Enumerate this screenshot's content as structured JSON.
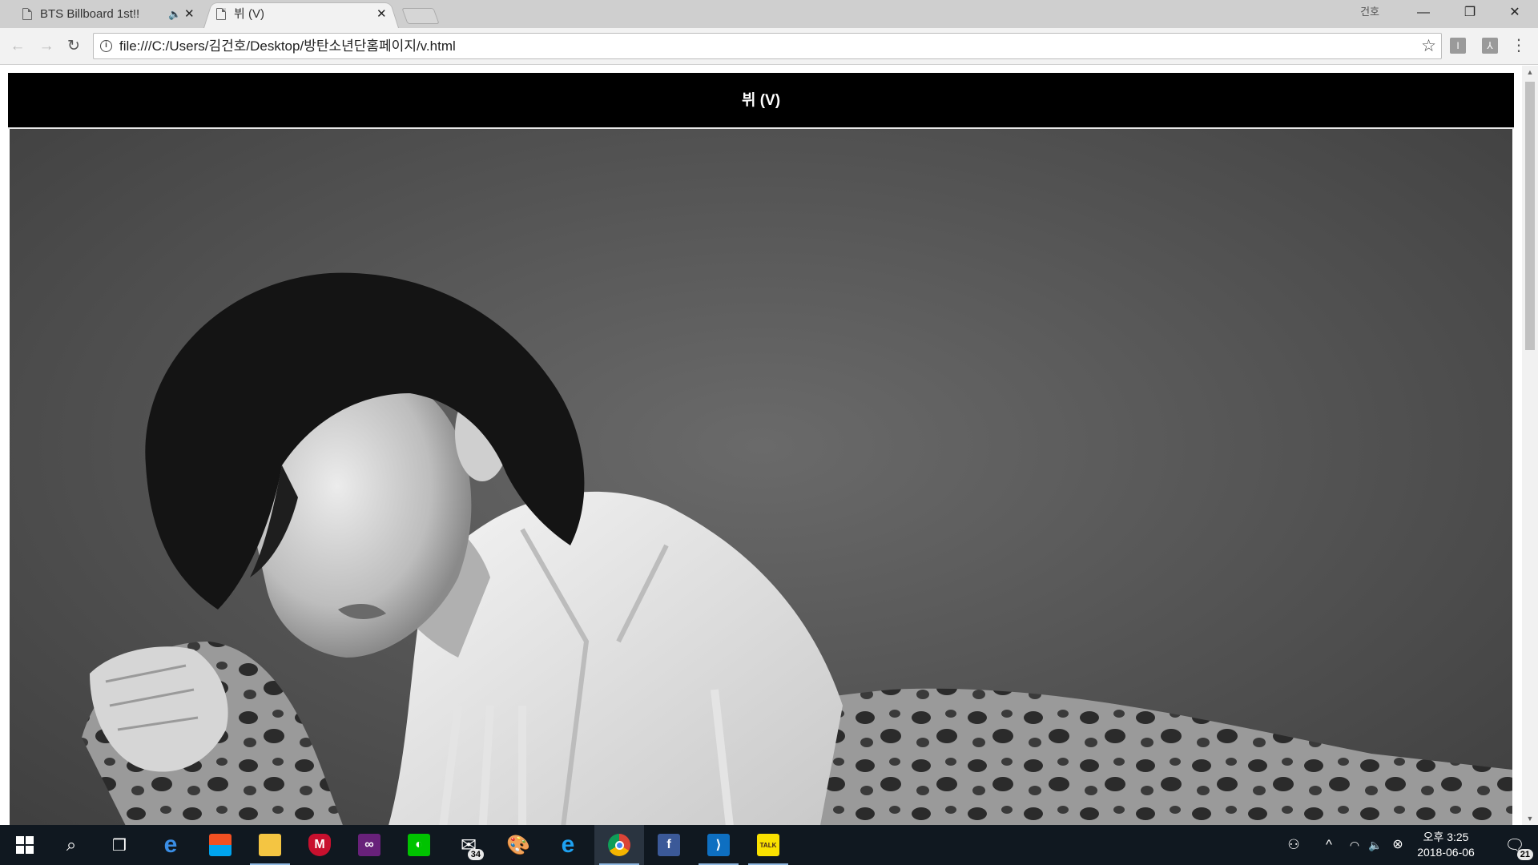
{
  "browser": {
    "tabs": [
      {
        "title": "BTS Billboard 1st!!",
        "active": false,
        "audio": true
      },
      {
        "title": "뷔 (V)",
        "active": true,
        "audio": false
      }
    ],
    "profile_name": "건호",
    "address": "file:///C:/Users/김건호/Desktop/방탄소년단홈페이지/v.html"
  },
  "page": {
    "heading": "뷔 (V)",
    "photo_description": "grayscale portrait photo"
  },
  "taskbar": {
    "apps": [
      "start",
      "search",
      "task-view",
      "edge",
      "store",
      "file-explorer",
      "mcafee",
      "visual-studio",
      "line",
      "mail",
      "paint",
      "internet-explorer",
      "chrome",
      "facebook",
      "vscode",
      "kakaotalk"
    ],
    "mail_badge": "34",
    "clock_time": "오후 3:25",
    "clock_date": "2018-06-06",
    "notification_count": "21"
  },
  "colors": {
    "header_bg": "#000000",
    "taskbar_bg": "#101820"
  }
}
